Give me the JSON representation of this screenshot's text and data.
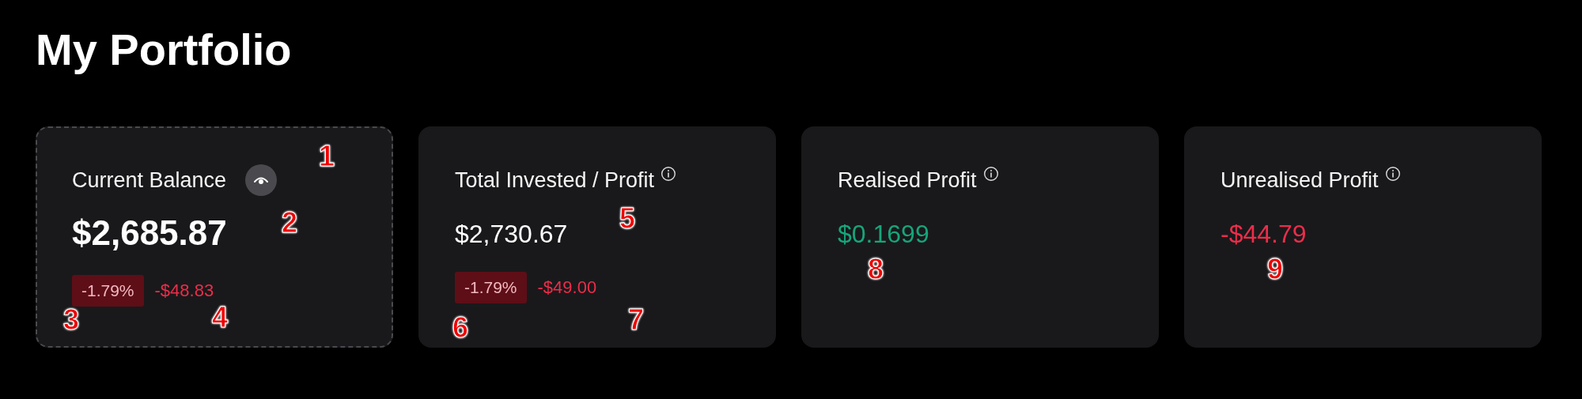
{
  "page": {
    "title": "My Portfolio"
  },
  "cards": [
    {
      "kind": "balance",
      "selected": true,
      "label": "Current Balance",
      "value": "$2,685.87",
      "color": "#ffffff",
      "change": {
        "percent": "-1.79%",
        "amount": "-$48.83",
        "color": "#ec2d4a"
      }
    },
    {
      "kind": "metric",
      "selected": false,
      "label": "Total Invested / Profit",
      "value": "$2,730.67",
      "color": "#ffffff",
      "change": {
        "percent": "-1.79%",
        "amount": "-$49.00",
        "color": "#ec2d4a"
      }
    },
    {
      "kind": "metric",
      "selected": false,
      "label": "Realised Profit",
      "value": "$0.1699",
      "color": "#17a57a"
    },
    {
      "kind": "metric",
      "selected": false,
      "label": "Unrealised Profit",
      "value": "-$44.79",
      "color": "#ec2d4a"
    }
  ],
  "annotations": [
    {
      "label": "1"
    },
    {
      "label": "2"
    },
    {
      "label": "3"
    },
    {
      "label": "4"
    },
    {
      "label": "5"
    },
    {
      "label": "6"
    },
    {
      "label": "7"
    },
    {
      "label": "8"
    },
    {
      "label": "9"
    }
  ]
}
